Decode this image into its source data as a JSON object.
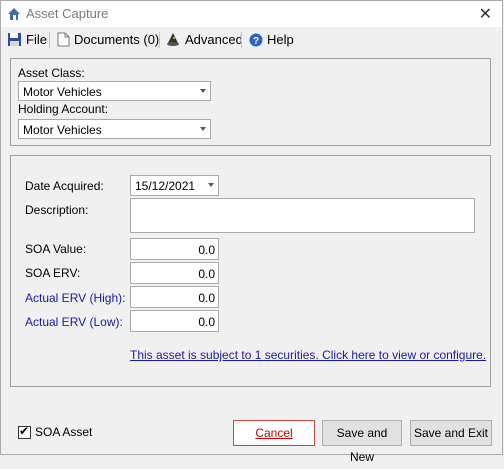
{
  "window": {
    "title": "Asset Capture",
    "close_glyph": "✕"
  },
  "menu": {
    "file": "File",
    "documents": "Documents (0)",
    "advanced": "Advanced",
    "help": "Help"
  },
  "asset_group": {
    "asset_class_label": "Asset Class:",
    "asset_class_value": "Motor Vehicles",
    "holding_account_label": "Holding Account:",
    "holding_account_value": "Motor Vehicles"
  },
  "details": {
    "date_acquired_label": "Date Acquired:",
    "date_acquired_value": "15/12/2021",
    "description_label": "Description:",
    "description_value": "",
    "soa_value_label": "SOA Value:",
    "soa_value": "0.0",
    "soa_erv_label": "SOA ERV:",
    "soa_erv": "0.0",
    "actual_erv_high_label": "Actual ERV (High):",
    "actual_erv_high": "0.0",
    "actual_erv_low_label": "Actual ERV (Low):",
    "actual_erv_low": "0.0",
    "securities_link": "This asset is subject to 1 securities.  Click here to view or configure."
  },
  "footer": {
    "soa_asset_label": "SOA Asset",
    "soa_asset_checked": true,
    "cancel_label": "Cancel",
    "save_new_label": "Save and New",
    "save_exit_label": "Save and Exit"
  },
  "colors": {
    "link": "#1a1aa6",
    "cancel_border": "#cc4444"
  },
  "icons": [
    "app-house-icon",
    "floppy-disk-icon",
    "document-icon",
    "wizard-hat-icon",
    "help-icon",
    "dropdown-arrow-icon",
    "checkmark-icon"
  ]
}
